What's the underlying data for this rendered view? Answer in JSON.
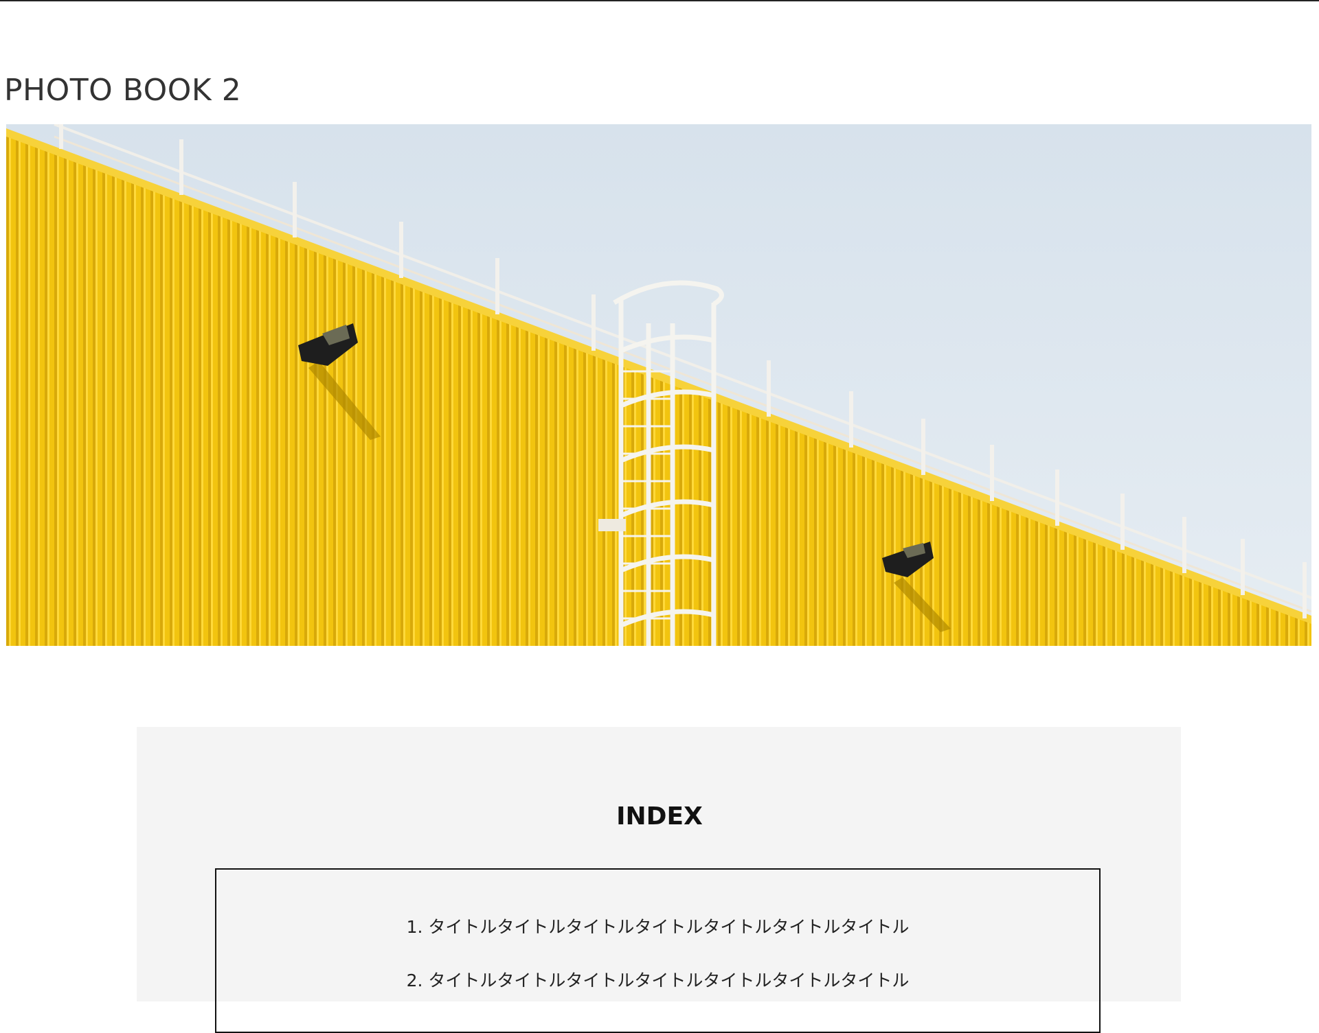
{
  "page_title": "PHOTO BOOK 2",
  "hero": {
    "icon": "photo-yellow-building-wall",
    "colors": {
      "sky": "#dce6ef",
      "wall": "#f2c40f",
      "wall_shadow": "#c9a000",
      "railing": "#f4f4f0"
    }
  },
  "index": {
    "heading": "INDEX",
    "items": [
      {
        "label": "1. タイトルタイトルタイトルタイトルタイトルタイトルタイトル"
      },
      {
        "label": "2. タイトルタイトルタイトルタイトルタイトルタイトルタイトル"
      }
    ]
  },
  "colors": {
    "title_text": "#333333",
    "panel_bg": "#f4f4f4",
    "border": "#111111"
  }
}
